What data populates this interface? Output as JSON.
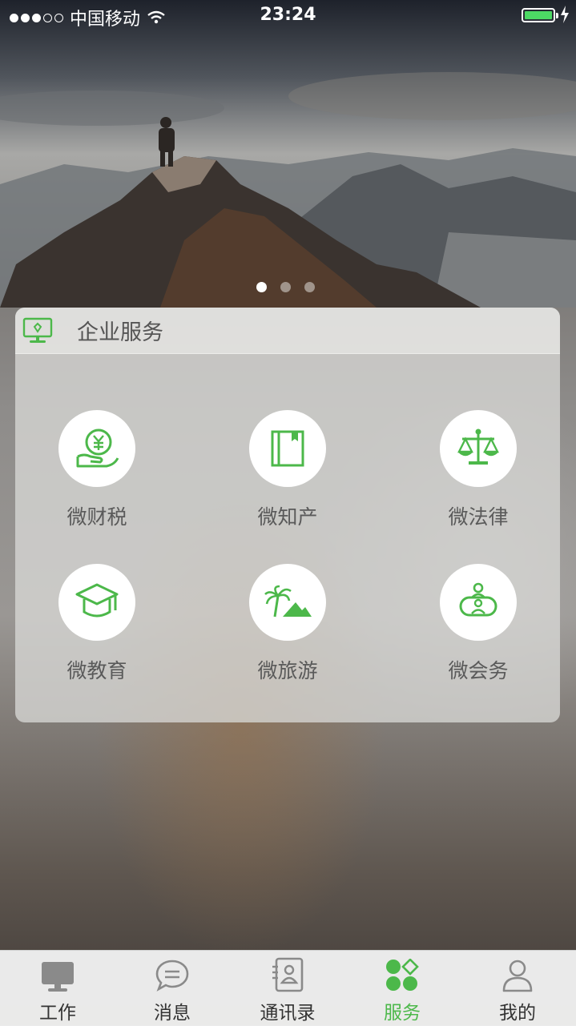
{
  "status_bar": {
    "carrier": "中国移动",
    "time": "23:24"
  },
  "banner": {
    "page_count": 3,
    "active_page": 1
  },
  "panel": {
    "title": "企业服务",
    "items": [
      {
        "label": "微财税",
        "icon": "money-hand-icon"
      },
      {
        "label": "微知产",
        "icon": "book-icon"
      },
      {
        "label": "微法律",
        "icon": "scale-icon"
      },
      {
        "label": "微教育",
        "icon": "graduation-cap-icon"
      },
      {
        "label": "微旅游",
        "icon": "palm-mountain-icon"
      },
      {
        "label": "微会务",
        "icon": "meeting-icon"
      }
    ]
  },
  "tabbar": {
    "tabs": [
      {
        "label": "工作",
        "icon": "monitor-icon"
      },
      {
        "label": "消息",
        "icon": "chat-icon"
      },
      {
        "label": "通讯录",
        "icon": "contacts-icon"
      },
      {
        "label": "服务",
        "icon": "service-icon",
        "active": true
      },
      {
        "label": "我的",
        "icon": "user-icon"
      }
    ]
  },
  "colors": {
    "accent": "#4cb84a",
    "battery": "#4cd964"
  }
}
